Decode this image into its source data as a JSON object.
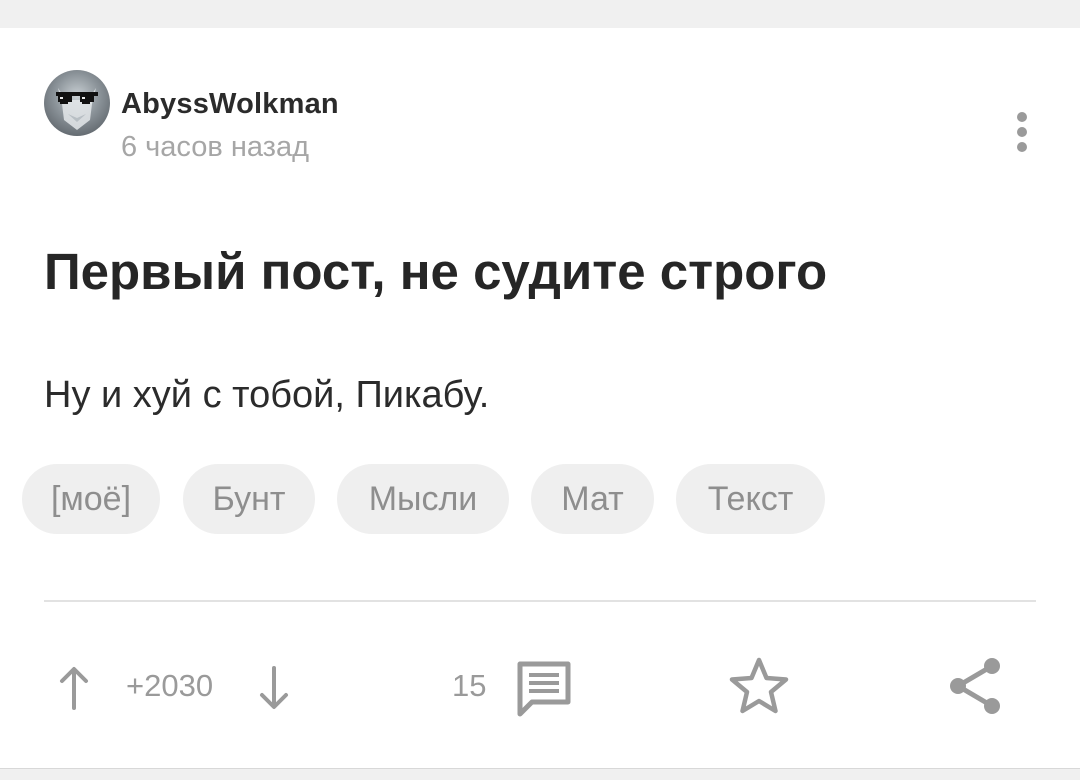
{
  "post": {
    "author": "AbyssWolkman",
    "time_ago": "6 часов назад",
    "title": "Первый пост, не судите строго",
    "body": "Ну и хуй с тобой, Пикабу.",
    "tags": [
      "[моё]",
      "Бунт",
      "Мысли",
      "Мат",
      "Текст"
    ]
  },
  "actions": {
    "rating": "+2030",
    "comments_count": "15"
  },
  "icons": {
    "avatar": "avatar-image",
    "more": "more-vertical-icon",
    "upvote": "arrow-up-icon",
    "downvote": "arrow-down-icon",
    "comments": "comment-icon",
    "save": "star-icon",
    "share": "share-icon"
  },
  "colors": {
    "text": "#2b2b2b",
    "muted": "#9a9a9a",
    "tag_bg": "#efefef"
  }
}
